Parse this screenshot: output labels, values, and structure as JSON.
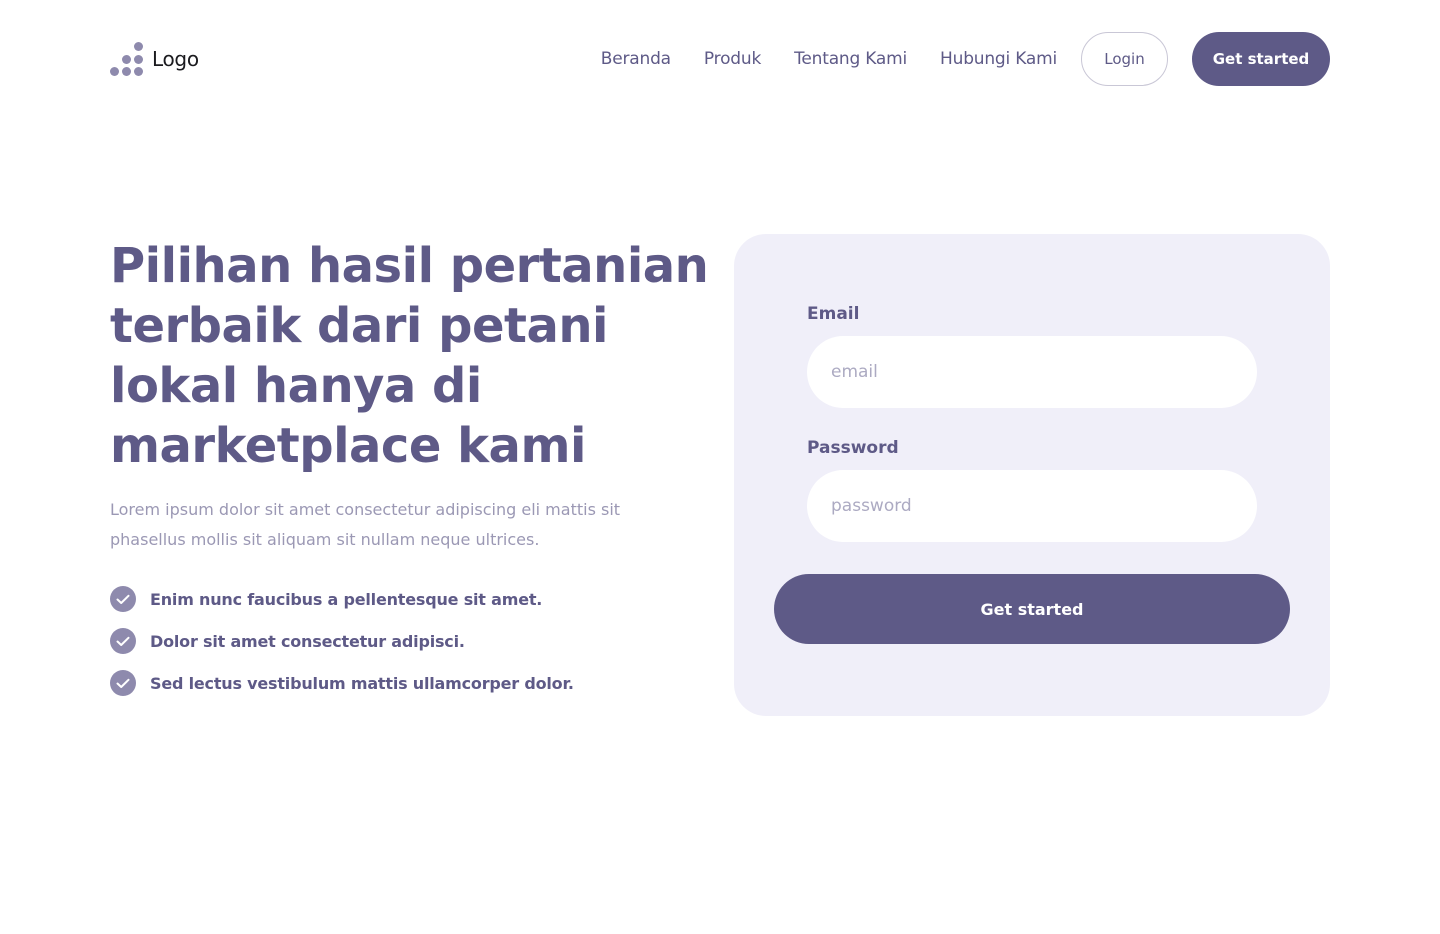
{
  "brand": {
    "logo_text": "Logo"
  },
  "nav": {
    "links": [
      "Beranda",
      "Produk",
      "Tentang Kami",
      "Hubungi Kami"
    ],
    "login_label": "Login",
    "cta_label": "Get started"
  },
  "hero": {
    "title": "Pilihan hasil pertanian terbaik dari petani lokal hanya di marketplace kami",
    "description": "Lorem ipsum dolor sit amet consectetur adipiscing eli mattis sit phasellus mollis sit aliquam sit nullam neque ultrices.",
    "features": [
      "Enim nunc faucibus a pellentesque sit amet.",
      "Dolor sit amet consectetur adipisci.",
      "Sed lectus vestibulum mattis ullamcorper dolor."
    ]
  },
  "form": {
    "email_label": "Email",
    "email_placeholder": "email",
    "email_value": "",
    "password_label": "Password",
    "password_placeholder": "password",
    "password_value": "",
    "submit_label": "Get started"
  },
  "icons": {
    "logo": "dots-logo-icon",
    "feature": "check-circle-icon"
  },
  "colors": {
    "primary": "#5e5a87",
    "accent_light": "#8e8aad",
    "card_bg": "#f0eff9",
    "muted_text": "#9b98b4"
  }
}
